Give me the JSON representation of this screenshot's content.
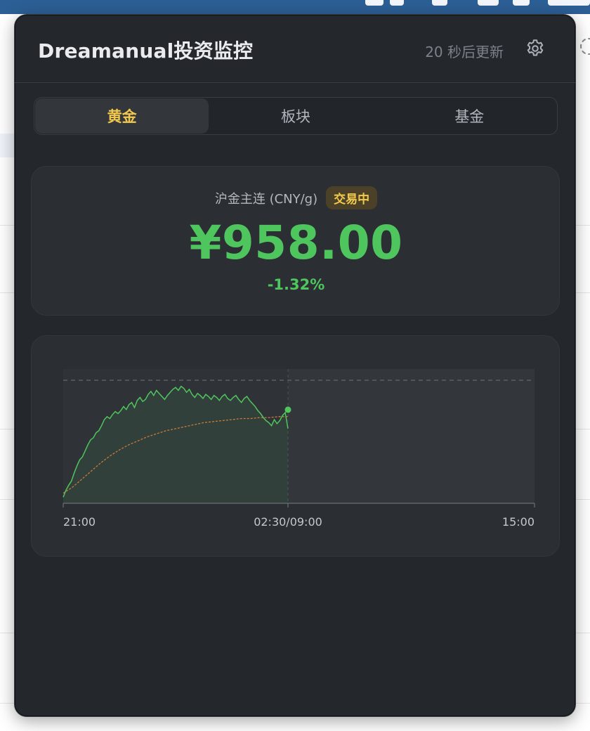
{
  "window": {
    "title": "Dreamanual投资监控",
    "refresh_status": "20 秒后更新",
    "settings_icon": "gear-icon"
  },
  "tabs": [
    {
      "label": "黄金",
      "active": true
    },
    {
      "label": "板块",
      "active": false
    },
    {
      "label": "基金",
      "active": false
    }
  ],
  "quote": {
    "name": "沪金主连 (CNY/g)",
    "status_badge": "交易中",
    "price": "¥958.00",
    "change": "-1.32%",
    "up_color": "#4fc55e",
    "badge_color": "#f2c94c"
  },
  "chart_data": {
    "type": "line",
    "x_ticks": [
      "21:00",
      "02:30/09:00",
      "15:00"
    ],
    "series": [
      {
        "style": "price",
        "color": "#4fc55e",
        "values": [
          951.2,
          951.9,
          952.4,
          952.8,
          953.6,
          954.3,
          954.9,
          955.2,
          955.8,
          956.4,
          956.9,
          957.1,
          957.6,
          957.8,
          958.3,
          958.9,
          959.2,
          959.0,
          959.4,
          959.7,
          959.5,
          959.8,
          960.2,
          959.9,
          960.4,
          960.6,
          960.1,
          960.8,
          961.1,
          960.7,
          960.9,
          961.4,
          961.7,
          961.3,
          961.8,
          961.5,
          961.2,
          960.9,
          961.3,
          961.6,
          961.9,
          962.1,
          961.8,
          962.2,
          962.0,
          961.6,
          961.9,
          961.4,
          961.1,
          961.5,
          961.3,
          961.0,
          961.4,
          961.2,
          960.9,
          961.3,
          961.1,
          960.8,
          961.2,
          961.4,
          961.0,
          960.8,
          961.1,
          961.3,
          960.9,
          960.6,
          961.0,
          961.2,
          960.8,
          960.5,
          960.2,
          959.8,
          959.5,
          959.1,
          958.8,
          958.6,
          958.3,
          958.9,
          958.5,
          958.8,
          959.3,
          959.6,
          958.0
        ],
        "values_note": ""
      },
      {
        "style": "average",
        "color": "#c97a3a",
        "values": [
          951.6,
          952.2,
          953.0,
          953.8,
          954.6,
          955.3,
          955.9,
          956.4,
          956.8,
          957.2,
          957.5,
          957.8,
          958.0,
          958.2,
          958.4,
          958.6,
          958.7,
          958.8,
          958.9,
          959.0,
          959.0,
          959.1,
          959.1,
          959.2,
          959.2
        ]
      }
    ],
    "prev_close_line": true,
    "grid": false
  }
}
